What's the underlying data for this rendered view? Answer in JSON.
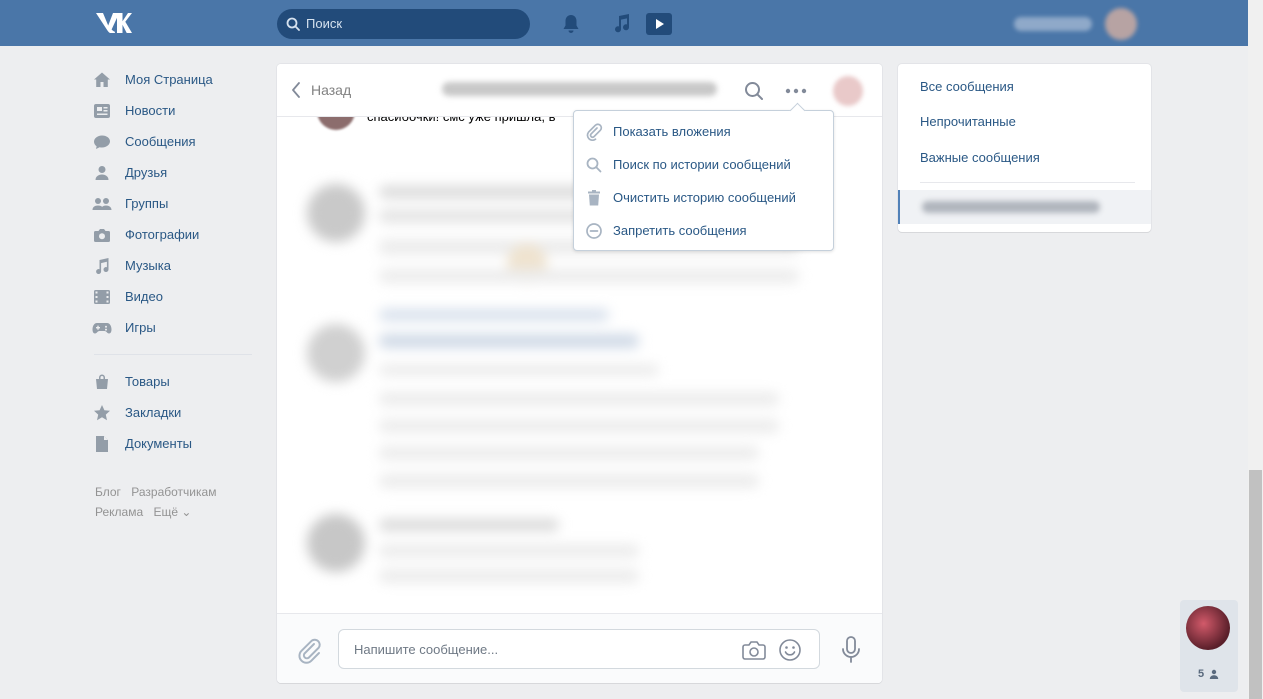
{
  "header": {
    "search_placeholder": "Поиск"
  },
  "nav": {
    "items": [
      {
        "label": "Моя Страница",
        "icon": "home-icon"
      },
      {
        "label": "Новости",
        "icon": "news-icon"
      },
      {
        "label": "Сообщения",
        "icon": "messages-icon"
      },
      {
        "label": "Друзья",
        "icon": "friends-icon"
      },
      {
        "label": "Группы",
        "icon": "groups-icon"
      },
      {
        "label": "Фотографии",
        "icon": "camera-icon"
      },
      {
        "label": "Музыка",
        "icon": "music-icon"
      },
      {
        "label": "Видео",
        "icon": "video-icon"
      },
      {
        "label": "Игры",
        "icon": "gamepad-icon"
      }
    ],
    "items2": [
      {
        "label": "Товары",
        "icon": "bag-icon"
      },
      {
        "label": "Закладки",
        "icon": "star-icon"
      },
      {
        "label": "Документы",
        "icon": "document-icon"
      }
    ],
    "footer": {
      "blog": "Блог",
      "developers": "Разработчикам",
      "ads": "Реклама",
      "more": "Ещё ⌄"
    }
  },
  "chat": {
    "back_label": "Назад",
    "top_message": "спасибочки! смс уже пришла, в",
    "composer_placeholder": "Напишите сообщение..."
  },
  "menu": {
    "items": [
      {
        "label": "Показать вложения",
        "icon": "paperclip-icon"
      },
      {
        "label": "Поиск по истории сообщений",
        "icon": "search-icon"
      },
      {
        "label": "Очистить историю сообщений",
        "icon": "trash-icon"
      },
      {
        "label": "Запретить сообщения",
        "icon": "block-icon"
      }
    ]
  },
  "filters": {
    "all": "Все сообщения",
    "unread": "Непрочитанные",
    "important": "Важные сообщения"
  },
  "chat_widget": {
    "count": "5"
  },
  "colors": {
    "brand": "#4a76a8",
    "link": "#2a5885",
    "background": "#edeef0"
  }
}
